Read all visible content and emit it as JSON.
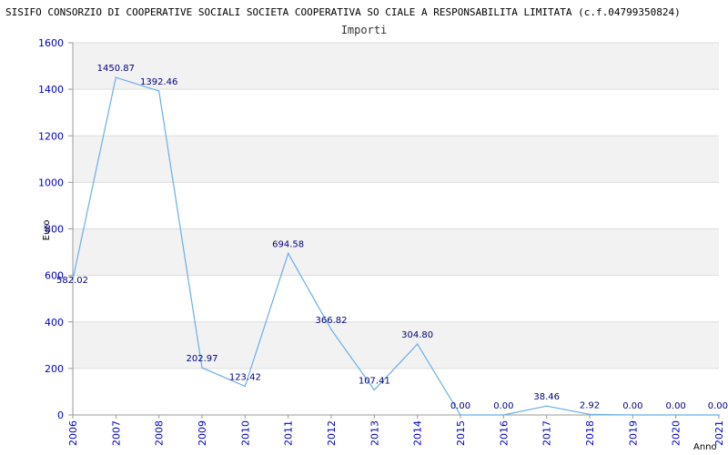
{
  "chart_data": {
    "type": "line",
    "title": "SISIFO CONSORZIO DI COOPERATIVE SOCIALI SOCIETA COOPERATIVA SO CIALE A RESPONSABILITA LIMITATA (c.f.04799350824)",
    "subtitle": "Importi",
    "ylabel": "Euro",
    "xlabel": "Anno",
    "ylim": [
      0,
      1600
    ],
    "yticks": [
      0,
      200,
      400,
      600,
      800,
      1000,
      1200,
      1400,
      1600
    ],
    "x": [
      "2006",
      "2007",
      "2008",
      "2009",
      "2010",
      "2011",
      "2012",
      "2013",
      "2014",
      "2015",
      "2016",
      "2017",
      "2018",
      "2019",
      "2020",
      "2021"
    ],
    "values": [
      582.02,
      1450.87,
      1392.46,
      202.97,
      123.42,
      694.58,
      366.82,
      107.41,
      304.8,
      0.0,
      0.0,
      38.46,
      2.92,
      0.0,
      0.0,
      0.0
    ],
    "value_labels": [
      "582.02",
      "1450.87",
      "1392.46",
      "202.97",
      "123.42",
      "694.58",
      "366.82",
      "107.41",
      "304.80",
      "0.00",
      "0.00",
      "38.46",
      "2.92",
      "0.00",
      "0.00",
      "0.00"
    ],
    "grid": true,
    "colors": {
      "line": "#6aaee8",
      "band": "#f2f2f2",
      "grid": "#dddddd",
      "tick": "#0000cc",
      "label": "#000080"
    }
  }
}
